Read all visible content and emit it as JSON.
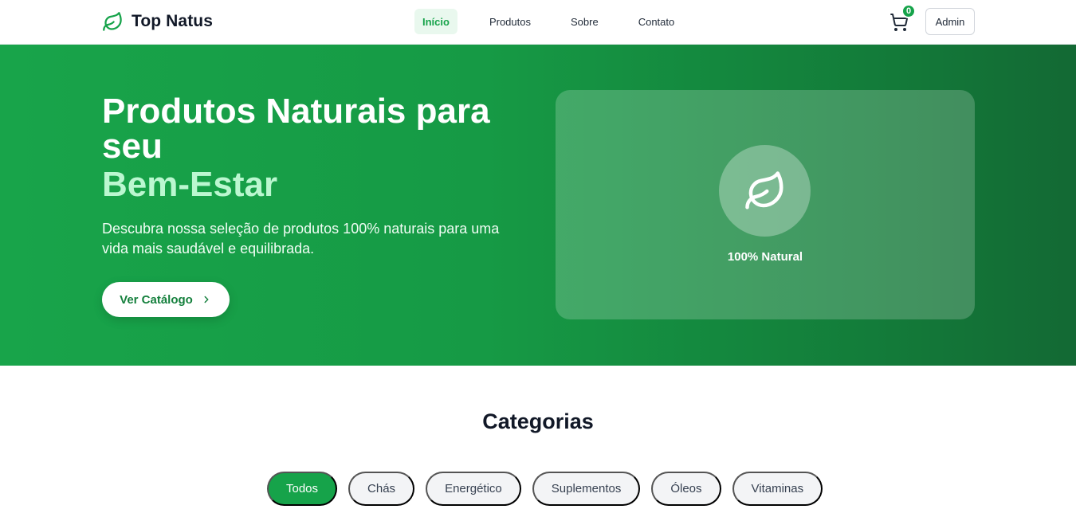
{
  "header": {
    "brand": "Top Natus",
    "nav": [
      {
        "label": "Início",
        "active": true
      },
      {
        "label": "Produtos",
        "active": false
      },
      {
        "label": "Sobre",
        "active": false
      },
      {
        "label": "Contato",
        "active": false
      }
    ],
    "cart_count": "0",
    "admin_label": "Admin"
  },
  "hero": {
    "title": "Produtos Naturais para seu",
    "title_accent": "Bem-Estar",
    "description": "Descubra nossa seleção de produtos 100% naturais para uma vida mais saudável e equilibrada.",
    "cta_label": "Ver Catálogo",
    "card_label": "100% Natural"
  },
  "categories": {
    "title": "Categorias",
    "items": [
      {
        "label": "Todos",
        "active": true
      },
      {
        "label": "Chás",
        "active": false
      },
      {
        "label": "Energético",
        "active": false
      },
      {
        "label": "Suplementos",
        "active": false
      },
      {
        "label": "Óleos",
        "active": false
      },
      {
        "label": "Vitaminas",
        "active": false
      }
    ]
  },
  "colors": {
    "brand_green": "#16a34a",
    "accent_light_green": "#bbf7d0",
    "active_nav_bg": "#e9f8ee",
    "chip_bg": "#f3f4f6"
  },
  "icons": {
    "brand": "leaf-icon",
    "cart": "shopping-cart-icon",
    "cta": "chevron-right-icon",
    "hero_card": "leaf-icon"
  }
}
